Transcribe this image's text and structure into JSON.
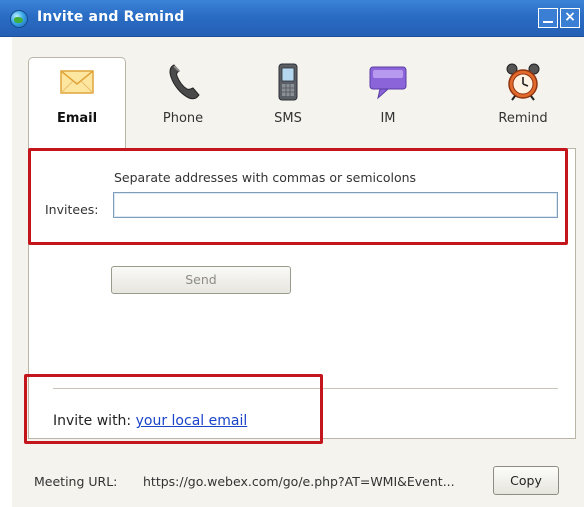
{
  "window": {
    "title": "Invite and Remind",
    "title_icon": "globe-icon",
    "controls": {
      "minimize_icon": "minimize-icon",
      "close_glyph": "×"
    }
  },
  "tabs": [
    {
      "label": "Email",
      "icon": "envelope-icon",
      "selected": true
    },
    {
      "label": "Phone",
      "icon": "phone-icon",
      "selected": false
    },
    {
      "label": "SMS",
      "icon": "mobile-phone-icon",
      "selected": false
    },
    {
      "label": "IM",
      "icon": "chat-bubble-icon",
      "selected": false
    },
    {
      "label": "Remind",
      "icon": "alarm-clock-icon",
      "selected": false
    }
  ],
  "email_panel": {
    "hint": "Separate addresses with commas or semicolons",
    "invitees_label": "Invitees:",
    "invitees_value": "",
    "send_label": "Send",
    "invite_with_label": "Invite with:",
    "invite_with_link": "your local email"
  },
  "footer": {
    "meeting_url_label": "Meeting URL:",
    "meeting_url_value": "https://go.webex.com/go/e.php?AT=WMI&Event...",
    "copy_label": "Copy"
  },
  "colors": {
    "titlebar": "#2a6cc4",
    "dialog_bg": "#f4f3ee",
    "highlight_box": "#c3161c",
    "link": "#1a44c9"
  }
}
